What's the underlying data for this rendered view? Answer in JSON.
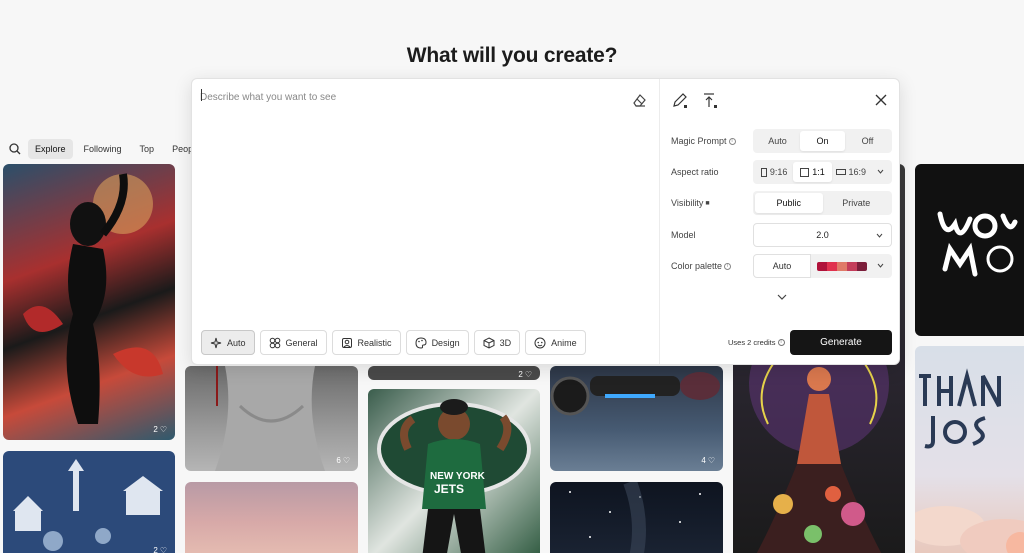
{
  "header": {
    "title": "What will you create?"
  },
  "nav": {
    "tabs": [
      {
        "label": "Explore"
      },
      {
        "label": "Following"
      },
      {
        "label": "Top"
      },
      {
        "label": "People"
      }
    ]
  },
  "composer": {
    "prompt": {
      "placeholder": "Describe what you want to see",
      "value": ""
    },
    "styles": [
      {
        "label": "Auto",
        "icon": "sparkle-icon",
        "active": true
      },
      {
        "label": "General",
        "icon": "grid-icon"
      },
      {
        "label": "Realistic",
        "icon": "portrait-icon"
      },
      {
        "label": "Design",
        "icon": "palette-icon"
      },
      {
        "label": "3D",
        "icon": "cube-icon"
      },
      {
        "label": "Anime",
        "icon": "face-icon"
      }
    ],
    "settings": {
      "magic_prompt": {
        "label": "Magic Prompt",
        "options": [
          "Auto",
          "On",
          "Off"
        ],
        "selected": "On"
      },
      "aspect_ratio": {
        "label": "Aspect ratio",
        "options": [
          "9:16",
          "1:1",
          "16:9"
        ],
        "selected": "1:1"
      },
      "visibility": {
        "label": "Visibility",
        "options": [
          "Public",
          "Private"
        ],
        "selected": "Public"
      },
      "model": {
        "label": "Model",
        "value": "2.0"
      },
      "color_palette": {
        "label": "Color palette",
        "auto_label": "Auto",
        "swatches": [
          "#b0123a",
          "#e0314e",
          "#e07a68",
          "#c43d5a",
          "#7b1d3a"
        ]
      }
    },
    "credits_text": "Uses 2 credits",
    "generate_label": "Generate"
  },
  "gallery": {
    "likes": [
      "2",
      "6",
      "2",
      "4",
      "2"
    ]
  },
  "colors": {
    "accent": "#151515",
    "background": "#f7f7f7"
  }
}
